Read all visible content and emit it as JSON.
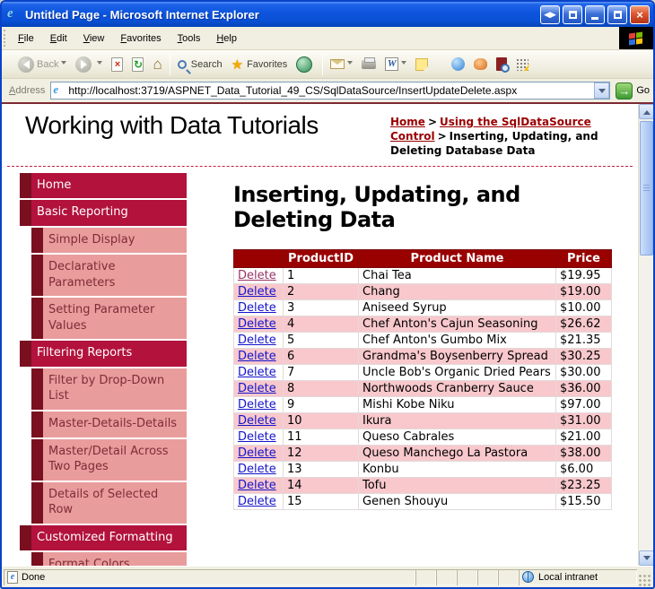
{
  "window": {
    "title": "Untitled Page - Microsoft Internet Explorer"
  },
  "menu_bar": {
    "items": [
      "File",
      "Edit",
      "View",
      "Favorites",
      "Tools",
      "Help"
    ]
  },
  "toolbar": {
    "back_label": "Back",
    "search_label": "Search",
    "favorites_label": "Favorites"
  },
  "address_bar": {
    "label": "Address",
    "url": "http://localhost:3719/ASPNET_Data_Tutorial_49_CS/SqlDataSource/InsertUpdateDelete.aspx",
    "go_label": "Go"
  },
  "page": {
    "site_title": "Working with Data Tutorials",
    "breadcrumb_separator": ">",
    "breadcrumb": [
      {
        "label": "Home",
        "link": true
      },
      {
        "label": "Using the SqlDataSource Control",
        "link": true
      },
      {
        "label": "Inserting, Updating, and Deleting Database Data",
        "link": false
      }
    ],
    "heading": "Inserting, Updating, and Deleting Data",
    "sidebar": [
      {
        "label": "Home",
        "level": 1
      },
      {
        "label": "Basic Reporting",
        "level": 1
      },
      {
        "label": "Simple Display",
        "level": 2
      },
      {
        "label": "Declarative Parameters",
        "level": 2
      },
      {
        "label": "Setting Parameter Values",
        "level": 2
      },
      {
        "label": "Filtering Reports",
        "level": 1
      },
      {
        "label": "Filter by Drop-Down List",
        "level": 2
      },
      {
        "label": "Master-Details-Details",
        "level": 2
      },
      {
        "label": "Master/Detail Across Two Pages",
        "level": 2
      },
      {
        "label": "Details of Selected Row",
        "level": 2
      },
      {
        "label": "Customized Formatting",
        "level": 1
      },
      {
        "label": "Format Colors",
        "level": 2
      }
    ],
    "table": {
      "delete_label": "Delete",
      "headers": [
        "",
        "ProductID",
        "Product Name",
        "Price"
      ],
      "rows": [
        {
          "id": 1,
          "name": "Chai Tea",
          "price": "$19.95",
          "visited": true
        },
        {
          "id": 2,
          "name": "Chang",
          "price": "$19.00"
        },
        {
          "id": 3,
          "name": "Aniseed Syrup",
          "price": "$10.00"
        },
        {
          "id": 4,
          "name": "Chef Anton's Cajun Seasoning",
          "price": "$26.62"
        },
        {
          "id": 5,
          "name": "Chef Anton's Gumbo Mix",
          "price": "$21.35"
        },
        {
          "id": 6,
          "name": "Grandma's Boysenberry Spread",
          "price": "$30.25"
        },
        {
          "id": 7,
          "name": "Uncle Bob's Organic Dried Pears",
          "price": "$30.00"
        },
        {
          "id": 8,
          "name": "Northwoods Cranberry Sauce",
          "price": "$36.00"
        },
        {
          "id": 9,
          "name": "Mishi Kobe Niku",
          "price": "$97.00"
        },
        {
          "id": 10,
          "name": "Ikura",
          "price": "$31.00"
        },
        {
          "id": 11,
          "name": "Queso Cabrales",
          "price": "$21.00"
        },
        {
          "id": 12,
          "name": "Queso Manchego La Pastora",
          "price": "$38.00"
        },
        {
          "id": 13,
          "name": "Konbu",
          "price": "$6.00"
        },
        {
          "id": 14,
          "name": "Tofu",
          "price": "$23.25"
        },
        {
          "id": 15,
          "name": "Genen Shouyu",
          "price": "$15.50"
        }
      ]
    }
  },
  "status_bar": {
    "left": "Done",
    "zone": "Local intranet"
  },
  "colors": {
    "nav_primary": "#b2123c",
    "nav_strip": "#7a0f1f",
    "nav_secondary": "#e99c9c",
    "nav_secondary_text": "#7f2c37",
    "table_header": "#990000",
    "table_alt_row": "#f8c8cc",
    "link_blue": "#1414cc",
    "link_visited": "#993366",
    "breadcrumb_link": "#990000"
  }
}
